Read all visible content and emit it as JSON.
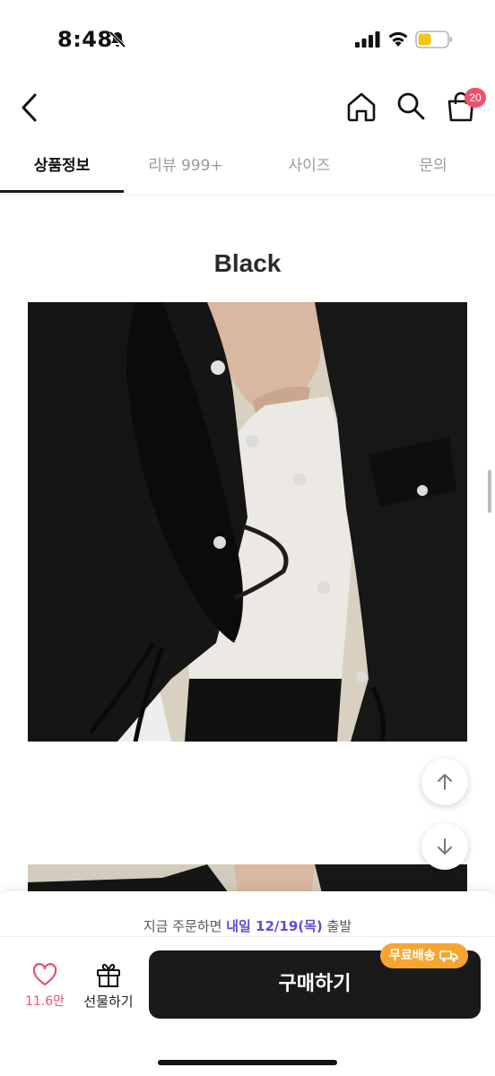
{
  "status": {
    "time": "8:48",
    "battery_color": "#f5c518"
  },
  "header": {
    "cart_badge": "20"
  },
  "tabs": [
    {
      "label": "상품정보",
      "active": true
    },
    {
      "label": "리뷰 999+",
      "active": false
    },
    {
      "label": "사이즈",
      "active": false
    },
    {
      "label": "문의",
      "active": false
    }
  ],
  "content": {
    "section_title": "Black"
  },
  "bottom_bar": {
    "delivery_prefix": "지금 주문하면 ",
    "delivery_highlight": "내일 12/19(목)",
    "delivery_suffix": " 출발",
    "like_count": "11.6만",
    "gift_label": "선물하기",
    "buy_label": "구매하기",
    "free_shipping_label": "무료배송"
  },
  "colors": {
    "accent_purple": "#5b4ed8",
    "badge_pink": "#f0506e",
    "heart_pink": "#e8506a",
    "free_ship_orange": "#f7a531",
    "buy_button_bg": "#1a1a1a"
  }
}
